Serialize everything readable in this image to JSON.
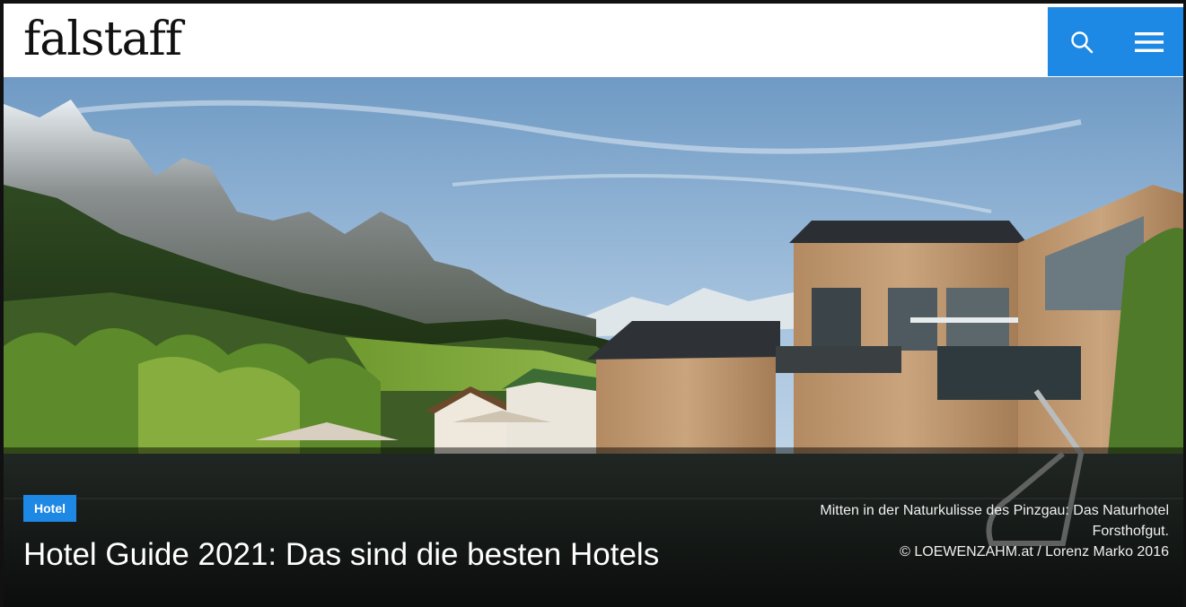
{
  "header": {
    "logo_text": "falstaff",
    "search_icon": "search-icon",
    "menu_icon": "hamburger-menu-icon",
    "accent_color": "#1e88e5"
  },
  "hero": {
    "category_tag": "Hotel",
    "title": "Hotel Guide 2021: Das sind die besten Hotels",
    "caption_line1": "Mitten in der Naturkulisse des Pinzgau: Das Naturhotel",
    "caption_line2": "Forsthofgut.",
    "credit": "© LOEWENZAHM.at / Lorenz Marko 2016"
  }
}
